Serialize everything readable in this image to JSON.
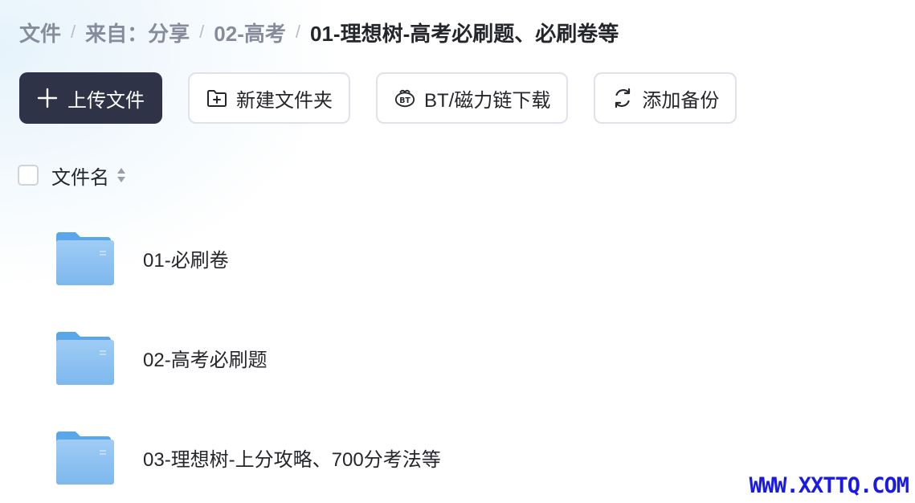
{
  "breadcrumb": {
    "items": [
      "文件",
      "来自：分享",
      "02-高考"
    ],
    "current": "01-理想树-高考必刷题、必刷卷等",
    "separator": "/"
  },
  "toolbar": {
    "upload_label": "上传文件",
    "new_folder_label": "新建文件夹",
    "bt_label": "BT/磁力链下载",
    "backup_label": "添加备份"
  },
  "list": {
    "header_name": "文件名",
    "items": [
      {
        "name": "01-必刷卷",
        "type": "folder"
      },
      {
        "name": "02-高考必刷题",
        "type": "folder"
      },
      {
        "name": "03-理想树-上分攻略、700分考法等",
        "type": "folder"
      }
    ]
  },
  "watermark": "WWW.XXTTQ.COM",
  "colors": {
    "primary_button": "#2f3347",
    "folder": "#7cb8ee",
    "watermark": "#1a1ae6"
  }
}
